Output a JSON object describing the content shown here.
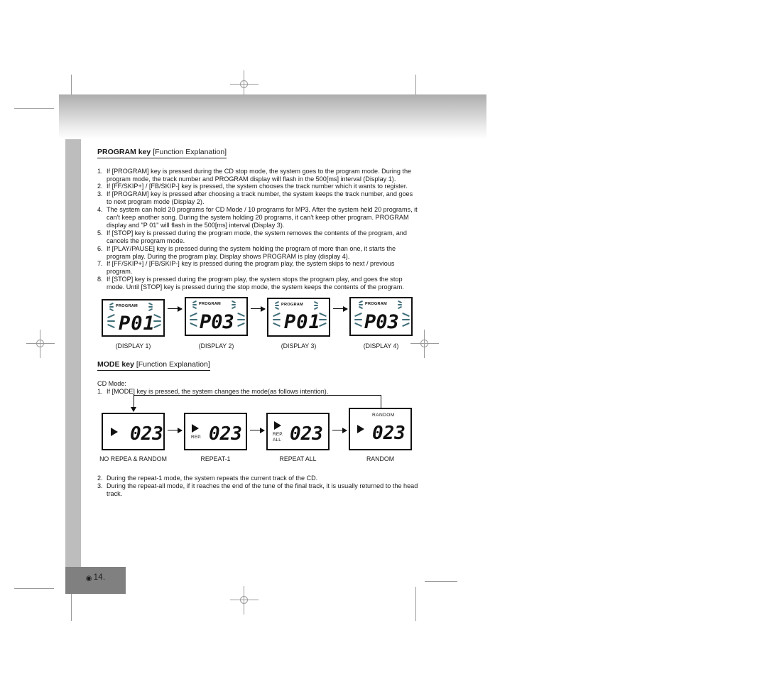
{
  "document": {
    "page_number": "14.",
    "page_glyph": "◉"
  },
  "program_section": {
    "heading_bold": "PROGRAM key",
    "heading_rest": " [Function Explanation]",
    "steps": [
      {
        "num": "1.",
        "text": "If [PROGRAM] key is pressed during the CD stop mode, the system goes to the program mode. During the program mode, the track number and PROGRAM display will flash in the 500[ms] interval (Display 1)."
      },
      {
        "num": "2.",
        "text": "If [FF/SKIP+] / [FB/SKIP-] key is pressed, the system chooses the track number which it wants to register."
      },
      {
        "num": "3.",
        "text": "If [PROGRAM] key is pressed after choosing a track number, the system keeps the track number, and goes to next program mode (Display 2)."
      },
      {
        "num": "4.",
        "text": "The system can hold 20 programs for CD Mode / 10 programs for MP3. After the system held 20 programs, it can't keep another song. During the system holding 20 programs, it can't keep other program. PROGRAM display and \"P 01\" will flash in the 500[ms] interval (Display 3)."
      },
      {
        "num": "5.",
        "text": "If [STOP] key is pressed during the program mode, the system removes the contents of the program, and cancels the program mode."
      },
      {
        "num": "6.",
        "text": "If [PLAY/PAUSE] key is pressed during the system holding the program of more than one, it starts the program play. During the program play, Display shows PROGRAM is play (display 4)."
      },
      {
        "num": "7.",
        "text": "If [FF/SKIP+] / [FB/SKIP-] key is pressed during the program play, the system skips to next / previous program."
      },
      {
        "num": "8.",
        "text": "If [STOP] key is pressed during the program play, the system stops the program play, and goes the stop mode. Until [STOP] key is pressed during the stop mode, the system keeps the contents of the program."
      }
    ],
    "displays": [
      {
        "indicator": "PROGRAM",
        "value": "P01",
        "caption": "(DISPLAY 1)",
        "flashing": true
      },
      {
        "indicator": "PROGRAM",
        "value": "P03",
        "caption": "(DISPLAY 2)",
        "flashing": true
      },
      {
        "indicator": "PROGRAM",
        "value": "P01",
        "caption": "(DISPLAY 3)",
        "flashing": true
      },
      {
        "indicator": "PROGRAM",
        "value": "P03",
        "caption": "(DISPLAY 4)",
        "flashing": true
      }
    ]
  },
  "mode_section": {
    "heading_bold": "MODE key",
    "heading_rest": " [Function Explanation]",
    "mode_label": "CD Mode:",
    "step_one": {
      "num": "1.",
      "text": "If [MODE] key is pressed, the system changes the mode(as follows intention)."
    },
    "displays": [
      {
        "value": "023",
        "caption": "NO REPEA & RANDOM",
        "play": true,
        "rep": "",
        "rep2": "",
        "random": ""
      },
      {
        "value": "023",
        "caption": "REPEAT-1",
        "play": true,
        "rep": "REP.",
        "rep2": "",
        "random": ""
      },
      {
        "value": "023",
        "caption": "REPEAT ALL",
        "play": true,
        "rep": "REP.",
        "rep2": "ALL",
        "random": ""
      },
      {
        "value": "023",
        "caption": "RANDOM",
        "play": true,
        "rep": "",
        "rep2": "",
        "random": "RANDOM"
      }
    ],
    "steps": [
      {
        "num": "2.",
        "text": "During the repeat-1 mode, the system repeats the current track of the CD."
      },
      {
        "num": "3.",
        "text": "During the repeat-all mode, if it reaches the end of the tune of the final track, it is usually returned to the head track."
      }
    ]
  },
  "colors": {
    "spine": "#bdbdbd",
    "footer_tab": "#808080",
    "flash_mark": "#3f6d78",
    "ink": "#111111",
    "reg_mark": "#9a9a9a"
  }
}
